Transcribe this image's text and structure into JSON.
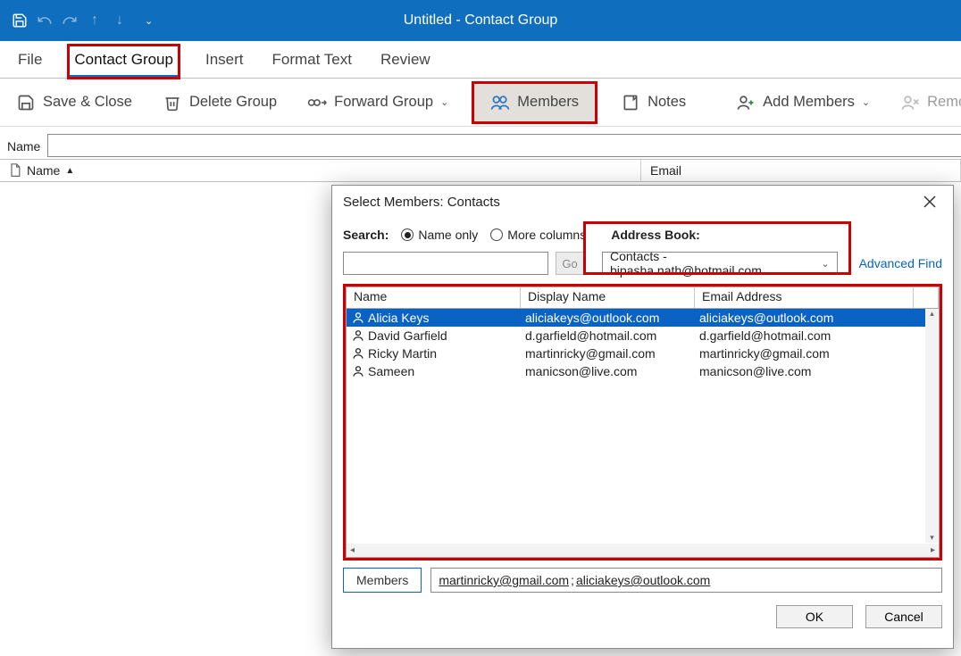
{
  "titlebar": {
    "title": "Untitled  -  Contact Group"
  },
  "tabs": {
    "file": "File",
    "contact_group": "Contact Group",
    "insert": "Insert",
    "format_text": "Format Text",
    "review": "Review"
  },
  "ribbon": {
    "save_close": "Save & Close",
    "delete_group": "Delete Group",
    "forward_group": "Forward Group",
    "members": "Members",
    "notes": "Notes",
    "add_members": "Add Members",
    "remove_member": "Remove Memb"
  },
  "name_field": {
    "label": "Name",
    "value": ""
  },
  "list_headers": {
    "name": "Name",
    "email": "Email"
  },
  "dialog": {
    "title": "Select Members: Contacts",
    "search_label": "Search:",
    "radio_name_only": "Name only",
    "radio_more_columns": "More columns",
    "address_book_label": "Address Book:",
    "go": "Go",
    "search_value": "",
    "address_book_value": "Contacts - bipasha.nath@hotmail.com",
    "advanced_find": "Advanced Find",
    "columns": {
      "name": "Name",
      "display": "Display Name",
      "email": "Email Address"
    },
    "rows": [
      {
        "name": "Alicia Keys",
        "display": "aliciakeys@outlook.com",
        "email": "aliciakeys@outlook.com",
        "selected": true
      },
      {
        "name": "David Garfield",
        "display": "d.garfield@hotmail.com",
        "email": "d.garfield@hotmail.com",
        "selected": false
      },
      {
        "name": "Ricky Martin",
        "display": "martinricky@gmail.com",
        "email": "martinricky@gmail.com",
        "selected": false
      },
      {
        "name": "Sameen",
        "display": "manicson@live.com",
        "email": "manicson@live.com",
        "selected": false
      }
    ],
    "members_button": "Members",
    "members_value_1": "martinricky@gmail.com",
    "members_sep": "; ",
    "members_value_2": "aliciakeys@outlook.com",
    "ok": "OK",
    "cancel": "Cancel"
  }
}
